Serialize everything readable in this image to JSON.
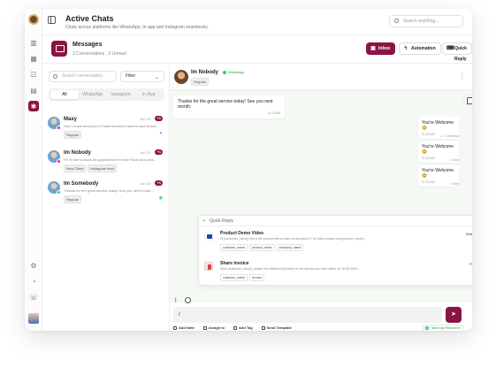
{
  "header": {
    "title": "Active Chats",
    "subtitle": "Chats across platforms like WhatsApp, In-app and Instagram seamlessly.",
    "search_placeholder": "Search anything..."
  },
  "messages": {
    "title": "Messages",
    "subtitle": "3 Conversations , 3 Unread",
    "buttons": {
      "inbox": "Inbox",
      "automation": "Automation",
      "quick_reply": "Quick Reply"
    }
  },
  "conversations": {
    "search_placeholder": "Search conversation...",
    "filter_label": "Filter",
    "tabs": [
      "All",
      "WhatsApp",
      "Instagram",
      "In-App"
    ],
    "items": [
      {
        "name": "Maxy",
        "date": "Jun 10",
        "badge": "+1",
        "preview": "Hey! I know about your Facial treatment options and would...",
        "tags": [
          "Regular"
        ],
        "channel_color": "#e1306c"
      },
      {
        "name": "Im Nobody",
        "date": "Jun 10",
        "badge": "+1",
        "preview": "Hi! I'd like to book an appointment for this Facial and woul...",
        "tags": [
          "New Client",
          "Instagram lead"
        ],
        "channel_color": "#e1306c"
      },
      {
        "name": "Im Somebody",
        "date": "Jun 10",
        "badge": "+1",
        "preview": "Thanks for the great service today! See you next month...",
        "tags": [
          "Regular"
        ],
        "channel_color": "#25d366"
      }
    ]
  },
  "chat": {
    "contact_name": "Im Nobody",
    "channel": "WhatsApp",
    "contact_tag": "Regular",
    "incoming": {
      "text": "Thanks for the great service today! See you next month.",
      "time": "11:23 AM"
    },
    "outgoing": [
      {
        "text": "You're Welcome 😊",
        "time": "11:23 AM",
        "status": "Delivered"
      },
      {
        "text": "You're Welcome 😊",
        "time": "11:23 AM",
        "status": "Sent"
      },
      {
        "text": "You're Welcome 😊",
        "time": "11:23 AM",
        "status": "Sent"
      }
    ]
  },
  "quick_reply": {
    "title": "Quick Reply",
    "items": [
      {
        "title": "Product Demo Video",
        "description": "Hi {customer_name} here's the product demo video as discussed. The video shows how {product_name}...",
        "tags": [
          "customer_name",
          "product_name",
          "company_name"
        ],
        "type": "Video"
      },
      {
        "title": "Share Invoice",
        "description": "Dear {customer_name}, please find attached {invoice} for the service you have taken on 18-06-2025...",
        "tags": [
          "customer_name",
          "Invoice"
        ],
        "type": "Pdf"
      }
    ]
  },
  "composer": {
    "input_value": "/",
    "actions": [
      "Add Note",
      "Assign to",
      "Add Tag",
      "Send Template"
    ],
    "resolve_label": "Mark as Resolved"
  },
  "colors": {
    "brand": "#8a1444",
    "success": "#1aa34a",
    "whatsapp": "#25d366",
    "instagram": "#e1306c"
  }
}
